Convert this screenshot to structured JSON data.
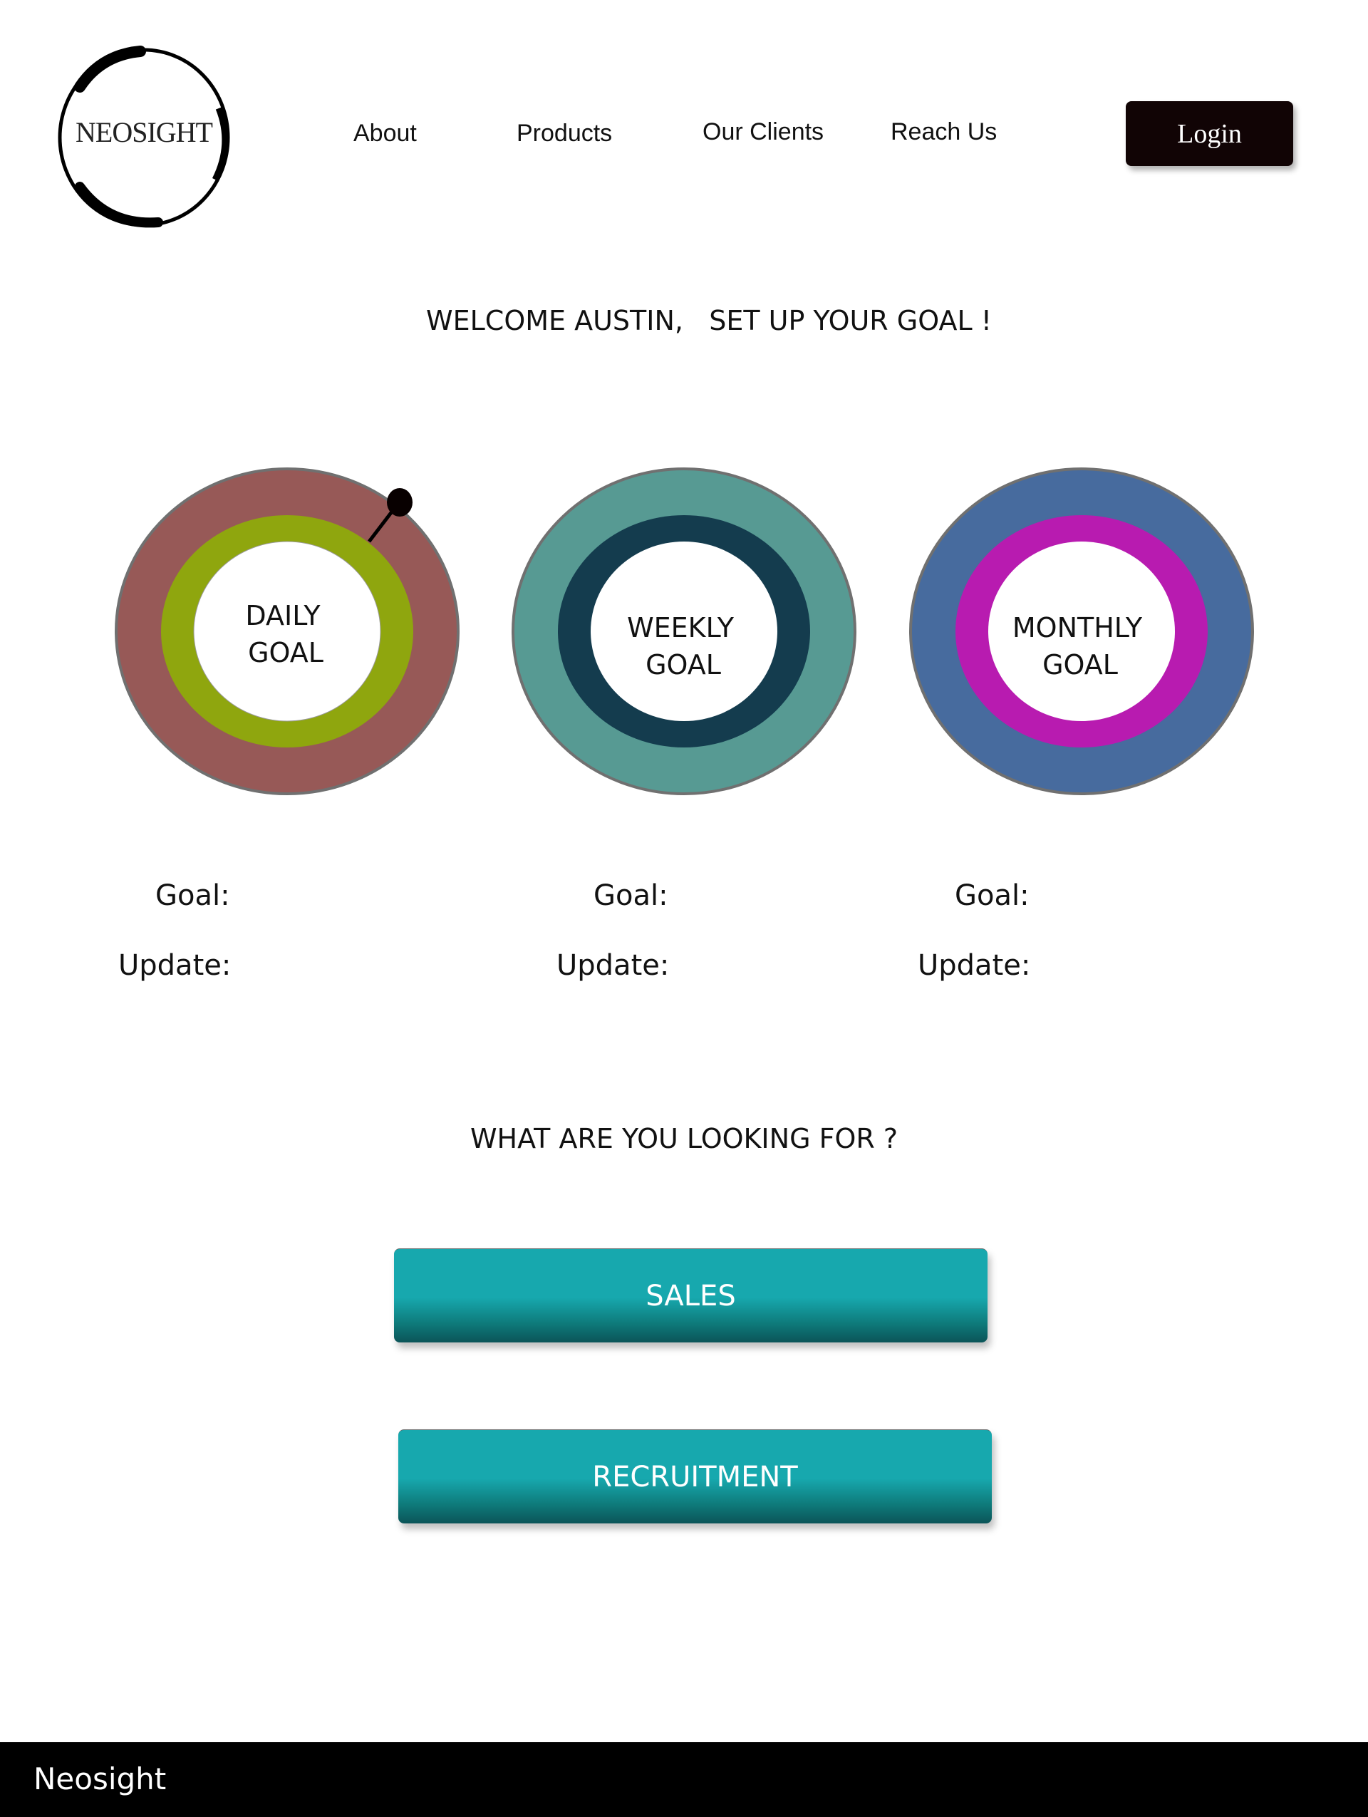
{
  "brand": {
    "logo_text": "NEOSIGHT"
  },
  "nav": {
    "items": [
      {
        "label": "About"
      },
      {
        "label": "Products"
      },
      {
        "label": "Our Clients"
      },
      {
        "label": "Reach Us"
      }
    ],
    "login_label": "Login"
  },
  "welcome": "WELCOME AUSTIN,   SET UP YOUR GOAL !",
  "goals": [
    {
      "line1": "DAILY",
      "line2": "GOAL",
      "goal_label": "Goal:",
      "update_label": "Update:",
      "outer_color": "#975957",
      "inner_color": "#8fa60e"
    },
    {
      "line1": "WEEKLY",
      "line2": "GOAL",
      "goal_label": "Goal:",
      "update_label": "Update:",
      "outer_color": "#579a93",
      "inner_color": "#143c4e"
    },
    {
      "line1": "MONTHLY",
      "line2": "GOAL",
      "goal_label": "Goal:",
      "update_label": "Update:",
      "outer_color": "#476b9e",
      "inner_color": "#b81bb0"
    }
  ],
  "question": "WHAT ARE YOU LOOKING FOR ?",
  "options": {
    "sales": "SALES",
    "recruitment": "RECRUITMENT"
  },
  "footer": {
    "brand": "Neosight"
  }
}
